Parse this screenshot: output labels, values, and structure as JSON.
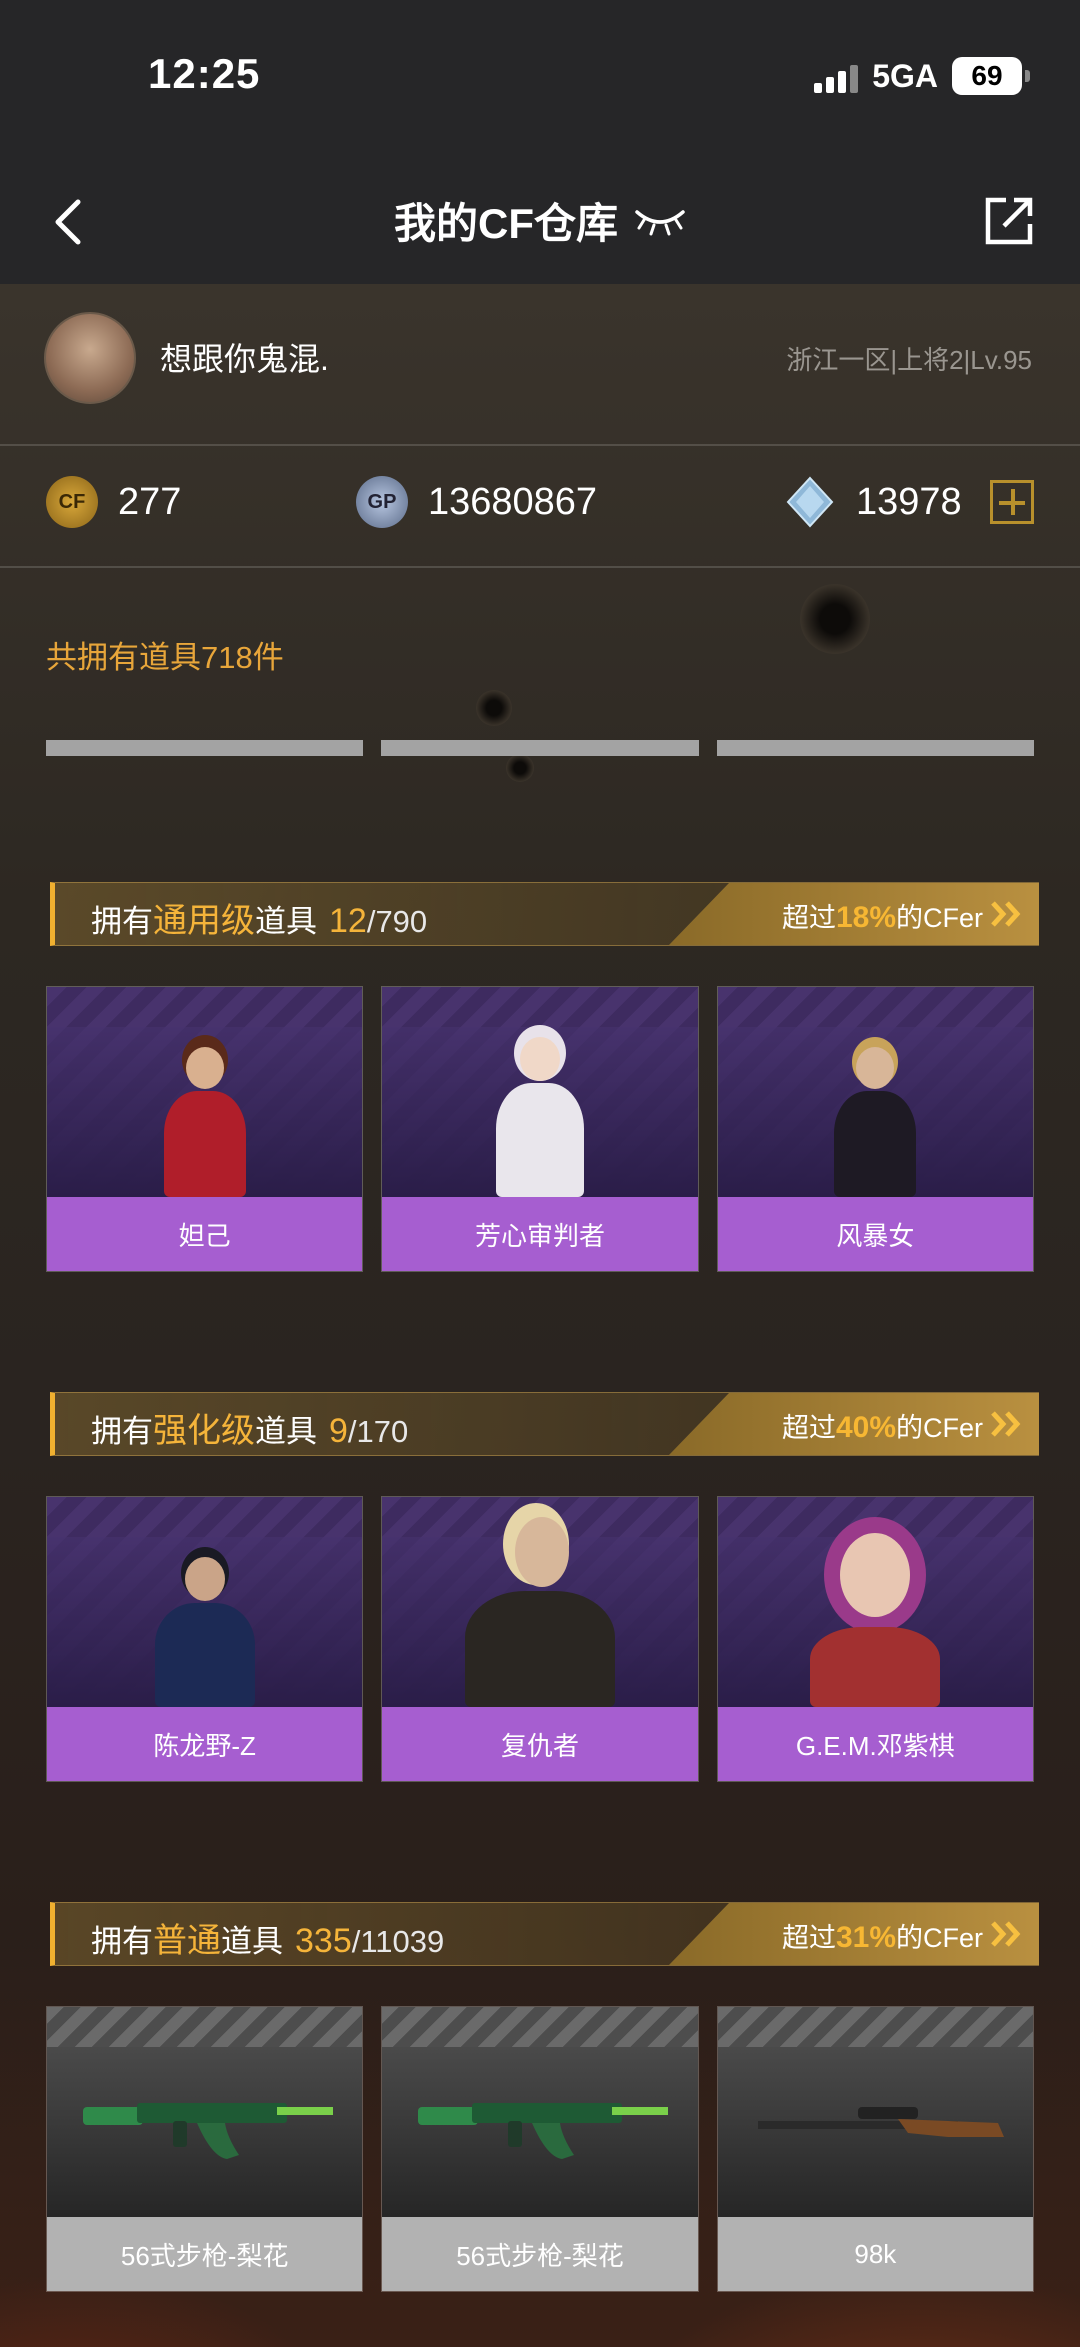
{
  "status": {
    "time": "12:25",
    "network": "5GA",
    "battery": "69"
  },
  "nav": {
    "title": "我的CF仓库"
  },
  "profile": {
    "nickname": "想跟你鬼混.",
    "server": "浙江一区|上将2|Lv.95"
  },
  "currency": {
    "cf_points": "277",
    "gp": "13680867",
    "diamonds": "13978",
    "cf_icon": "CF",
    "gp_icon": "GP"
  },
  "total_items": "共拥有道具718件",
  "sections": [
    {
      "prefix": "拥有",
      "grade": "通用级",
      "suffix": "道具",
      "owned": "12",
      "total": "/790",
      "exceed_prefix": "超过",
      "percent": "18%",
      "exceed_suffix": "的CFer",
      "items": [
        "妲己",
        "芳心审判者",
        "风暴女"
      ]
    },
    {
      "prefix": "拥有",
      "grade": "强化级",
      "suffix": "道具",
      "owned": "9",
      "total": "/170",
      "exceed_prefix": "超过",
      "percent": "40%",
      "exceed_suffix": "的CFer",
      "items": [
        "陈龙野-Z",
        "复仇者",
        "G.E.M.邓紫棋"
      ]
    },
    {
      "prefix": "拥有",
      "grade": "普通",
      "suffix": "道具",
      "owned": "335",
      "total": "/11039",
      "exceed_prefix": "超过",
      "percent": "31%",
      "exceed_suffix": "的CFer",
      "items": [
        "56式步枪-梨花",
        "56式步枪-梨花",
        "98k"
      ]
    }
  ],
  "colors": {
    "accent": "#f5b43a",
    "card_purple": "#a65ed0",
    "card_grey": "#b2b2b2"
  }
}
